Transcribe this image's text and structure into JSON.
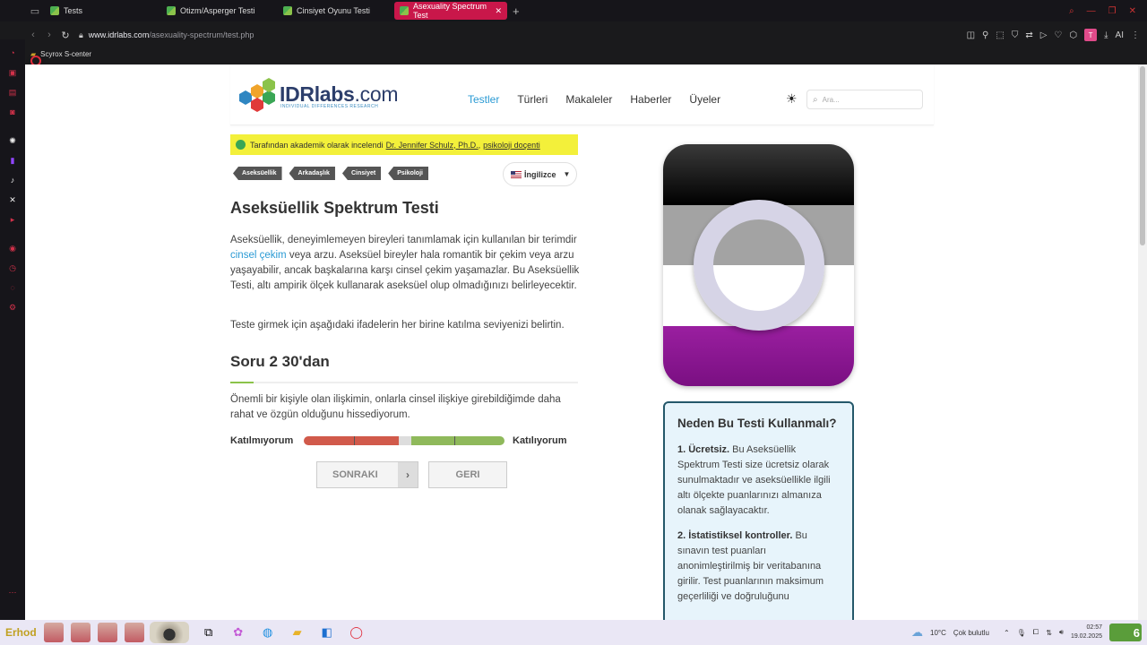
{
  "browser": {
    "tabs": [
      {
        "label": "Tests",
        "active": false
      },
      {
        "label": "Otizm/Asperger Testi",
        "active": false
      },
      {
        "label": "Cinsiyet Oyunu Testi",
        "active": false
      },
      {
        "label": "Asexuality Spectrum Test",
        "active": true
      }
    ],
    "url_domain": "www.idrlabs.com",
    "url_path": "/asexuality-spectrum/test.php",
    "profile_letter": "T",
    "ai_label": "AI",
    "bookmark": "Scyrox S-center",
    "accent": "#c9174a"
  },
  "site": {
    "brand": "IDRlabs",
    "brand_suffix": ".com",
    "tagline": "INDIVIDUAL DIFFERENCES RESEARCH",
    "nav": [
      "Testler",
      "Türleri",
      "Makaleler",
      "Haberler",
      "Üyeler"
    ],
    "search_placeholder": "Ara..."
  },
  "review": {
    "prefix": "Tarafından akademik olarak incelendi",
    "reviewer": "Dr. Jennifer Schulz, Ph.D.",
    "sep": ",",
    "role": "psikoloji doçenti"
  },
  "tags": [
    "Aseksüellik",
    "Arkadaşlık",
    "Cinsiyet",
    "Psikoloji"
  ],
  "language": "İngilizce",
  "test": {
    "title": "Aseksüellik Spektrum Testi",
    "intro_before_link": "Aseksüellik, deneyimlemeyen bireyleri tanımlamak için kullanılan bir terimdir ",
    "intro_link": "cinsel çekim",
    "intro_after_link": " veya arzu. Aseksüel bireyler hala romantik bir çekim veya arzu yaşayabilir, ancak başkalarına karşı cinsel çekim yaşamazlar. Bu Aseksüellik Testi, altı ampirik ölçek kullanarak aseksüel olup olmadığınızı belirleyecektir.",
    "instruction": "Teste girmek için aşağıdaki ifadelerin her birine katılma seviyenizi belirtin.",
    "question_counter": "Soru 2 30'dan",
    "progress": 0.067,
    "question": "Önemli bir kişiyle olan ilişkimin, onlarla cinsel ilişkiye girebildiğimde daha rahat ve özgün olduğunu hissediyorum.",
    "scale_left": "Katılmıyorum",
    "scale_right": "Katılıyorum",
    "next_label": "SONRAKI",
    "back_label": "GERI"
  },
  "why": {
    "title": "Neden Bu Testi Kullanmalı?",
    "items": [
      {
        "head": "1. Ücretsiz.",
        "text": " Bu Aseksüellik Spektrum Testi size ücretsiz olarak sunulmaktadır ve aseksüellikle ilgili altı ölçekte puanlarınızı almanıza olanak sağlayacaktır."
      },
      {
        "head": "2. İstatistiksel kontroller.",
        "text": " Bu sınavın test puanları anonimleştirilmiş bir veritabanına girilir. Test puanlarının maksimum geçerliliği ve doğruluğunu"
      }
    ]
  },
  "taskbar": {
    "user": "Erhod",
    "weather_temp": "10°C",
    "weather_text": "Çok bulutlu",
    "time": "02:57",
    "date": "19.02.2025",
    "notif": "6"
  }
}
